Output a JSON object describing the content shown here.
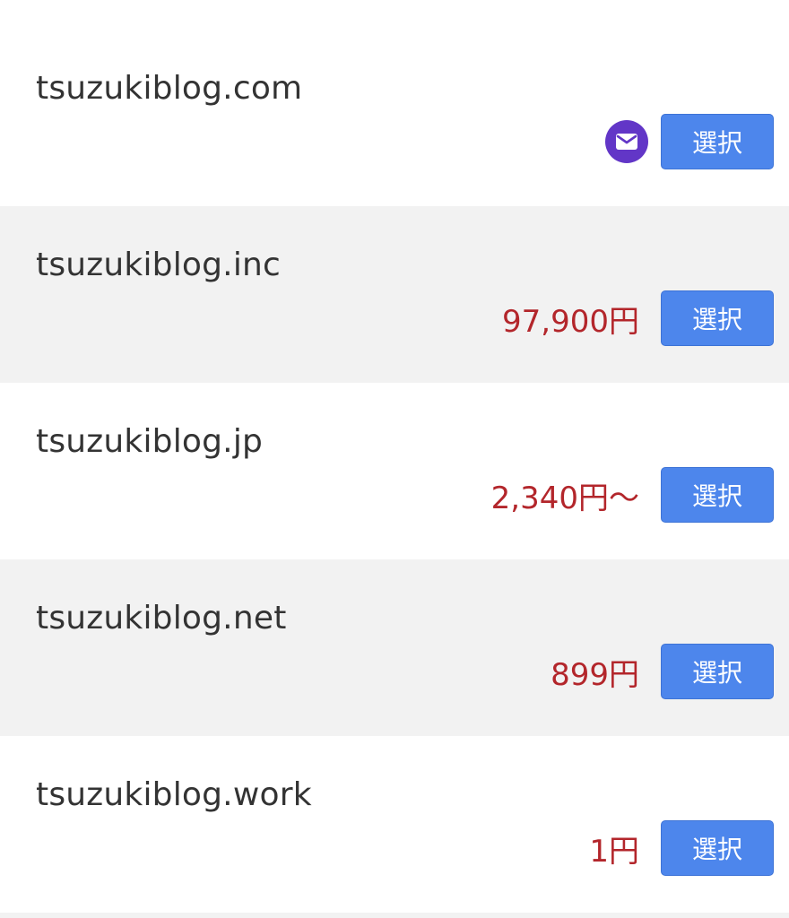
{
  "domains": [
    {
      "name": "tsuzukiblog.com",
      "price": "",
      "badge": "mail-icon",
      "button_label": "選択"
    },
    {
      "name": "tsuzukiblog.inc",
      "price": "97,900円",
      "badge": "",
      "button_label": "選択"
    },
    {
      "name": "tsuzukiblog.jp",
      "price": "2,340円〜",
      "badge": "",
      "button_label": "選択"
    },
    {
      "name": "tsuzukiblog.net",
      "price": "899円",
      "badge": "",
      "button_label": "選択"
    },
    {
      "name": "tsuzukiblog.work",
      "price": "1円",
      "badge": "",
      "button_label": "選択"
    }
  ],
  "colors": {
    "price": "#b3262b",
    "button": "#4d86ec",
    "badge": "#6236c7",
    "row_shaded": "#f2f2f2"
  }
}
